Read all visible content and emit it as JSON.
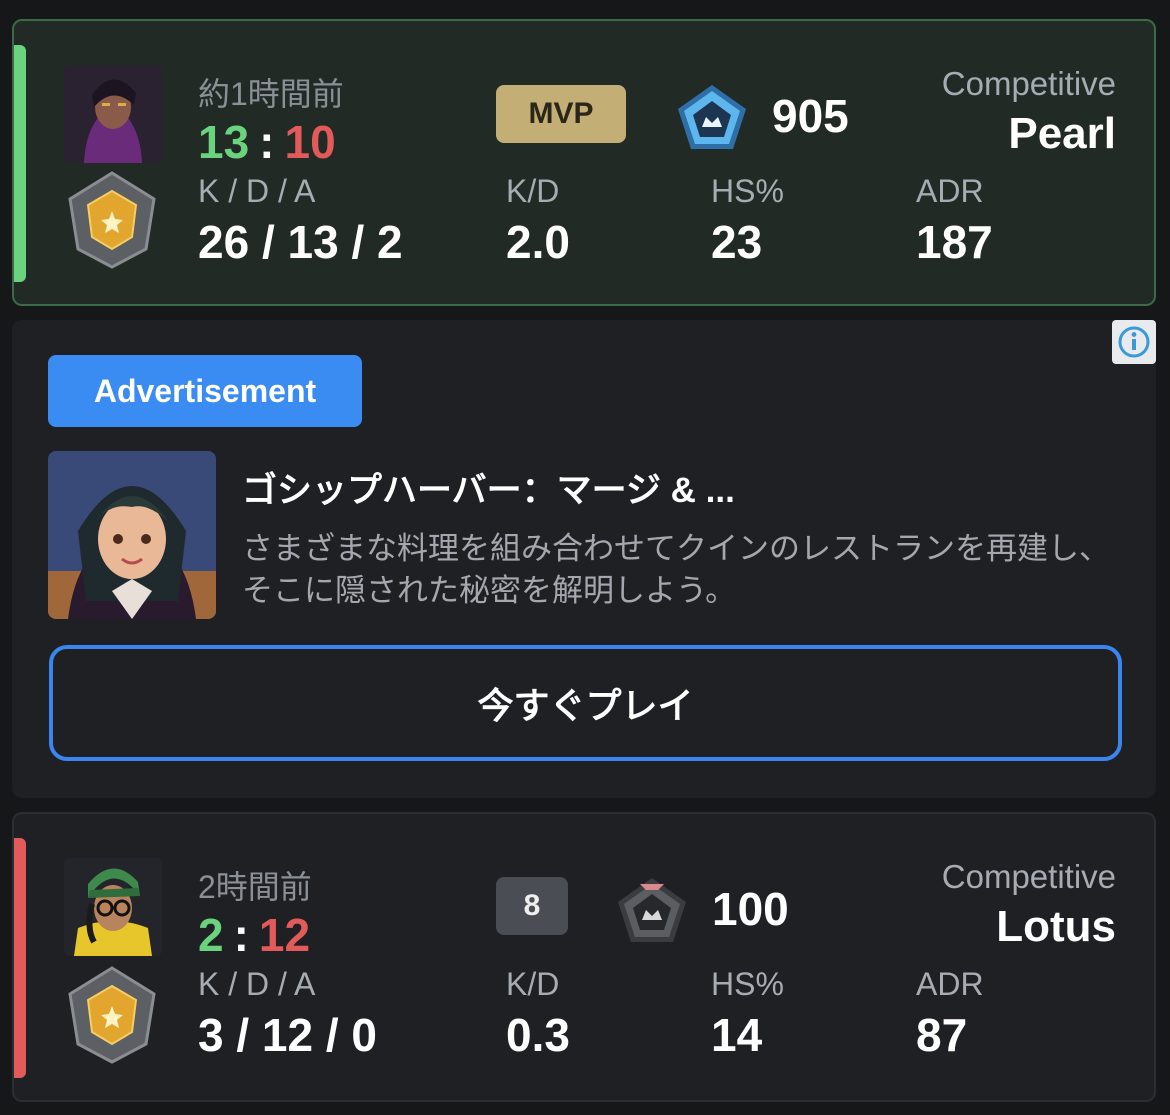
{
  "colors": {
    "win": "#6ad37e",
    "loss": "#e35a5a",
    "accent": "#3b8cf2",
    "mvp": "#c3ae75"
  },
  "matches": [
    {
      "result": "win",
      "time_ago": "約1時間前",
      "score_team": "13",
      "score_sep": ":",
      "score_enemy": "10",
      "badge": "MVP",
      "rr_icon": "pentagon-rank-icon",
      "rr_value": "905",
      "mode": "Competitive",
      "map": "Pearl",
      "kda_label": "K / D / A",
      "kda_value": "26 / 13 / 2",
      "kd_label": "K/D",
      "kd_value": "2.0",
      "hs_label": "HS%",
      "hs_value": "23",
      "adr_label": "ADR",
      "adr_value": "187"
    },
    {
      "result": "loss",
      "time_ago": "2時間前",
      "score_team": "2",
      "score_sep": ":",
      "score_enemy": "12",
      "badge": "8",
      "rr_icon": "pentagon-rank-icon",
      "rr_value": "100",
      "mode": "Competitive",
      "map": "Lotus",
      "kda_label": "K / D / A",
      "kda_value": "3 / 12 / 0",
      "kd_label": "K/D",
      "kd_value": "0.3",
      "hs_label": "HS%",
      "hs_value": "14",
      "adr_label": "ADR",
      "adr_value": "87"
    }
  ],
  "ad": {
    "badge": "Advertisement",
    "info_icon": "info-icon",
    "title": "ゴシップハーバー：マージ & ...",
    "description": "さまざまな料理を組み合わせてクインのレストランを再建し、そこに隠された秘密を解明しよう。",
    "cta": "今すぐプレイ"
  }
}
